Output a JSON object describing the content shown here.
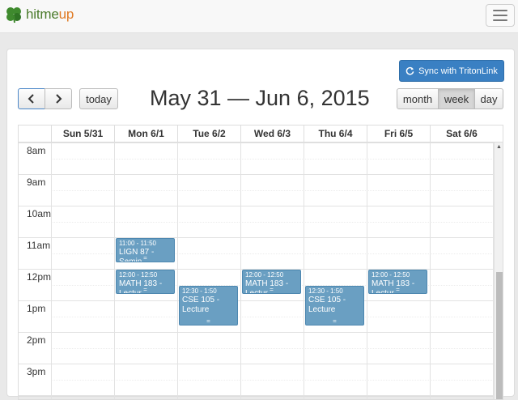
{
  "brand": {
    "name_part1": "hitme",
    "name_part2": "up",
    "logo_icon": "clover-icon"
  },
  "navbar": {
    "menu_icon": "hamburger-menu-icon"
  },
  "toolbar": {
    "sync_label": "Sync with TritonLink",
    "sync_icon": "refresh-icon",
    "prev_icon": "chevron-left-icon",
    "next_icon": "chevron-right-icon",
    "today_label": "today",
    "title": "May 31 — Jun 6, 2015",
    "views": [
      "month",
      "week",
      "day"
    ],
    "active_view": "week"
  },
  "calendar": {
    "days": [
      "Sun 5/31",
      "Mon 6/1",
      "Tue 6/2",
      "Wed 6/3",
      "Thu 6/4",
      "Fri 6/5",
      "Sat 6/6"
    ],
    "times": [
      "8am",
      "9am",
      "10am",
      "11am",
      "12pm",
      "1pm",
      "2pm",
      "3pm"
    ],
    "events": [
      {
        "day": 1,
        "time": "11:00 - 11:50",
        "title": "LIGN 87 - Semin"
      },
      {
        "day": 1,
        "time": "12:00 - 12:50",
        "title": "MATH 183 - Lectur"
      },
      {
        "day": 3,
        "time": "12:00 - 12:50",
        "title": "MATH 183 - Lectur"
      },
      {
        "day": 5,
        "time": "12:00 - 12:50",
        "title": "MATH 183 - Lectur"
      },
      {
        "day": 2,
        "time": "12:30 - 1:50",
        "title": "CSE 105 - Lecture"
      },
      {
        "day": 4,
        "time": "12:30 - 1:50",
        "title": "CSE 105 - Lecture"
      }
    ]
  },
  "colors": {
    "accent": "#3a80c3",
    "event": "#6a9fc2"
  }
}
